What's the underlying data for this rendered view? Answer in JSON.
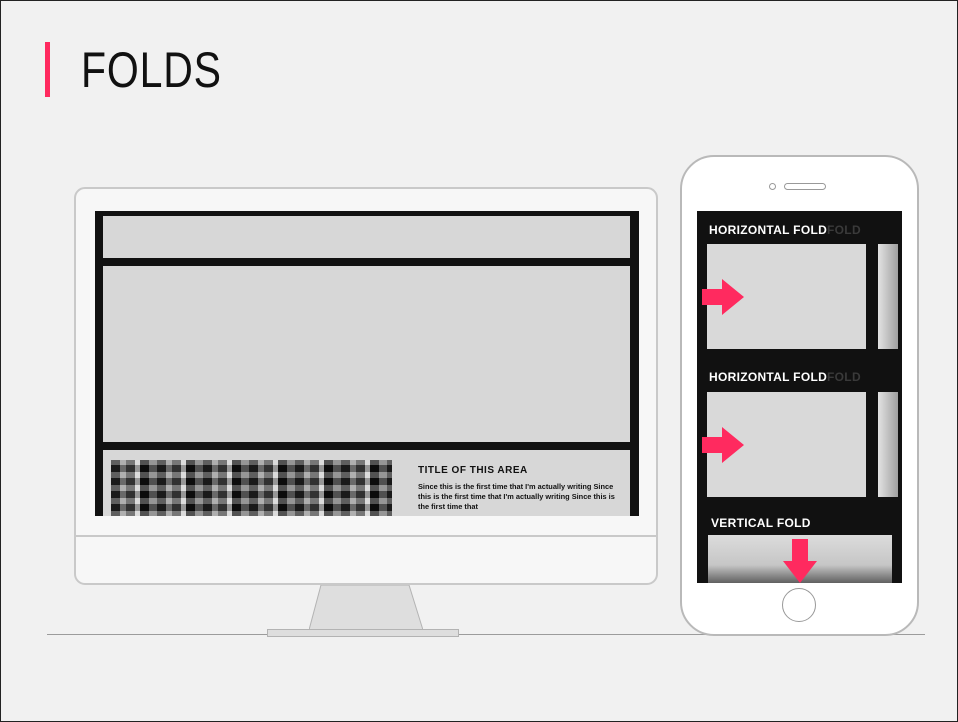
{
  "slide": {
    "title": "FOLDS",
    "accent_color": "#ff2a5f"
  },
  "desktop": {
    "area_title": "TITLE OF THIS AREA",
    "area_body": "Since this is the first time that I'm actually writing Since this is the first time that I'm actually writing Since this is the first time that"
  },
  "phone": {
    "fold_1_label": "HORIZONTAL FOLD",
    "fold_1_ghost": "FOLD",
    "fold_2_label": "HORIZONTAL FOLD",
    "fold_2_ghost": "FOLD",
    "fold_3_label": "VERTICAL FOLD"
  },
  "icons": [
    "arrow-right-icon",
    "arrow-right-icon",
    "arrow-down-icon"
  ]
}
